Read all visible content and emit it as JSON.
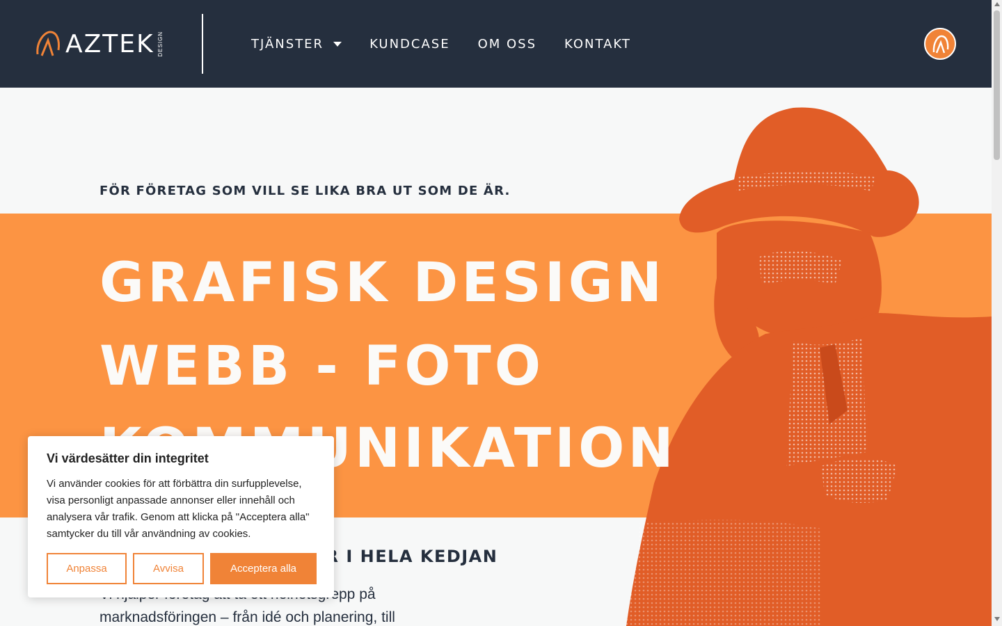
{
  "header": {
    "logo": {
      "text_main": "AZTEK",
      "text_sub": "DESIGN"
    },
    "nav": [
      {
        "label": "TJÄNSTER",
        "has_dropdown": true
      },
      {
        "label": "KUNDCASE"
      },
      {
        "label": "OM OSS"
      },
      {
        "label": "KONTAKT"
      }
    ],
    "badge_icon": "aztek-a-icon"
  },
  "hero": {
    "tagline": "FÖR FÖRETAG SOM VILL SE LIKA BRA UT SOM DE ÄR.",
    "headline_lines": [
      "GRAFISK DESIGN",
      "WEBB - FOTO",
      "KOMMUNIKATION"
    ],
    "sub_heading": "VI FINNS NÄRA MED ER I HELA KEDJAN",
    "body": "Vi hjälper företag att ta ett helhetsgrepp på marknadsföringen – från idé och planering, till"
  },
  "cookie_banner": {
    "title": "Vi värdesätter din integritet",
    "text": "Vi använder cookies för att förbättra din surfupplevelse, visa personligt anpassade annonser eller innehåll och analysera vår trafik. Genom att klicka på \"Acceptera alla\" samtycker du till vår användning av cookies.",
    "buttons": {
      "customize": "Anpassa",
      "reject": "Avvisa",
      "accept": "Acceptera alla"
    }
  },
  "colors": {
    "header_bg": "#252f3e",
    "accent": "#f08337",
    "band": "#fc9443",
    "portrait": "#e15d27"
  }
}
